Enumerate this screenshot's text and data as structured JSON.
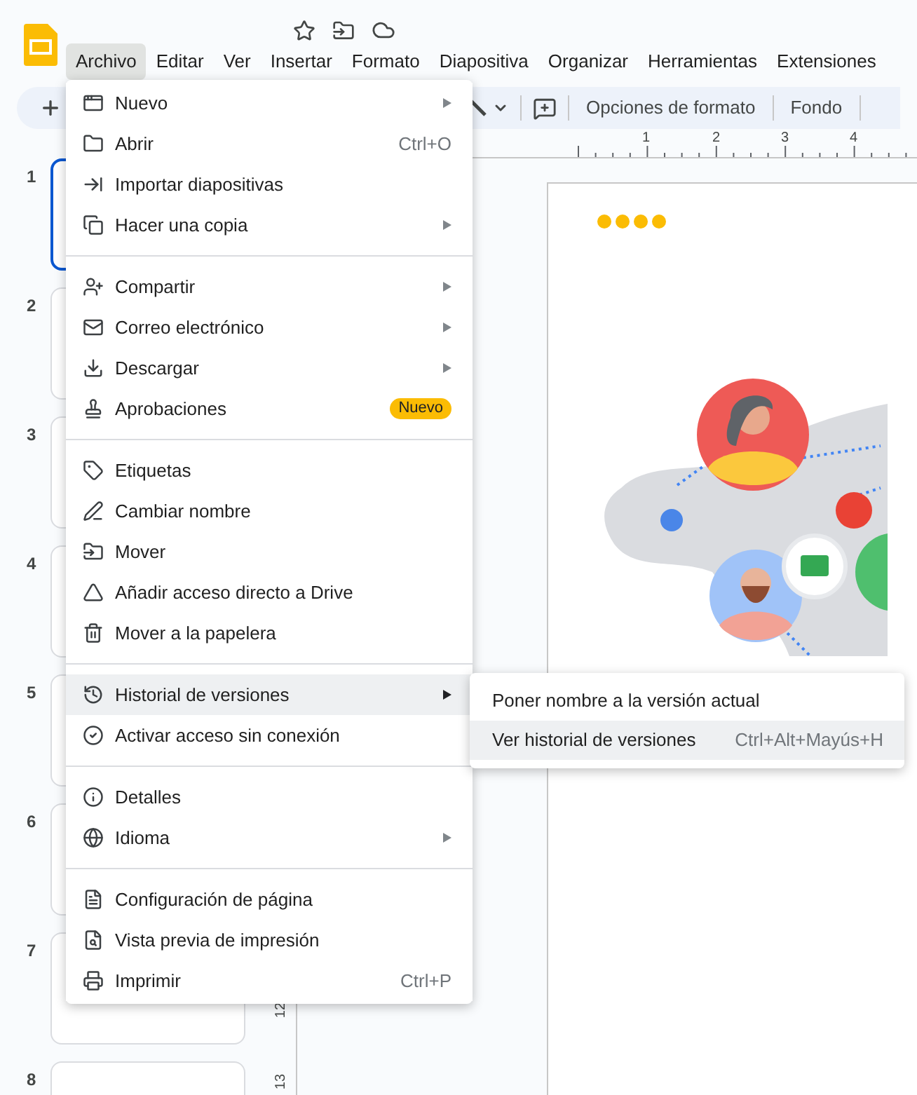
{
  "menu_bar": [
    {
      "label": "Archivo",
      "selected": true
    },
    {
      "label": "Editar",
      "selected": false
    },
    {
      "label": "Ver",
      "selected": false
    },
    {
      "label": "Insertar",
      "selected": false
    },
    {
      "label": "Formato",
      "selected": false
    },
    {
      "label": "Diapositiva",
      "selected": false
    },
    {
      "label": "Organizar",
      "selected": false
    },
    {
      "label": "Herramientas",
      "selected": false
    },
    {
      "label": "Extensiones",
      "selected": false
    }
  ],
  "toolbar": {
    "buttons": [
      "Opciones de formato",
      "Fondo"
    ]
  },
  "ruler": {
    "marks": [
      "1",
      "2",
      "3",
      "4"
    ]
  },
  "vertical_ruler": {
    "marks": [
      "12",
      "13"
    ]
  },
  "slides": [
    {
      "number": "1",
      "selected": true
    },
    {
      "number": "2",
      "selected": false
    },
    {
      "number": "3",
      "selected": false
    },
    {
      "number": "4",
      "selected": false
    },
    {
      "number": "5",
      "selected": false
    },
    {
      "number": "6",
      "selected": false
    },
    {
      "number": "7",
      "selected": false
    },
    {
      "number": "8",
      "selected": false
    }
  ],
  "file_menu": {
    "sections": [
      [
        {
          "label": "Nuevo",
          "has_submenu": true,
          "selected": false
        },
        {
          "label": "Abrir",
          "shortcut": "Ctrl+O",
          "has_submenu": false,
          "selected": false
        },
        {
          "label": "Importar diapositivas",
          "has_submenu": false,
          "selected": false
        },
        {
          "label": "Hacer una copia",
          "has_submenu": true,
          "selected": false
        }
      ],
      [
        {
          "label": "Compartir",
          "has_submenu": true,
          "selected": false
        },
        {
          "label": "Correo electrónico",
          "has_submenu": true,
          "selected": false
        },
        {
          "label": "Descargar",
          "has_submenu": true,
          "selected": false
        },
        {
          "label": "Aprobaciones",
          "badge": "Nuevo",
          "has_submenu": false,
          "selected": false
        }
      ],
      [
        {
          "label": "Etiquetas",
          "has_submenu": false,
          "selected": false
        },
        {
          "label": "Cambiar nombre",
          "has_submenu": false,
          "selected": false
        },
        {
          "label": "Mover",
          "has_submenu": false,
          "selected": false
        },
        {
          "label": "Añadir acceso directo a Drive",
          "has_submenu": false,
          "selected": false
        },
        {
          "label": "Mover a la papelera",
          "has_submenu": false,
          "selected": false
        }
      ],
      [
        {
          "label": "Historial de versiones",
          "has_submenu": true,
          "selected": true
        },
        {
          "label": "Activar acceso sin conexión",
          "has_submenu": false,
          "selected": false
        }
      ],
      [
        {
          "label": "Detalles",
          "has_submenu": false,
          "selected": false
        },
        {
          "label": "Idioma",
          "has_submenu": true,
          "selected": false
        }
      ],
      [
        {
          "label": "Configuración de página",
          "has_submenu": false,
          "selected": false
        },
        {
          "label": "Vista previa de impresión",
          "has_submenu": false,
          "selected": false
        },
        {
          "label": "Imprimir",
          "shortcut": "Ctrl+P",
          "has_submenu": false,
          "selected": false
        }
      ]
    ]
  },
  "version_submenu": {
    "items": [
      {
        "label": "Poner nombre a la versión actual",
        "selected": false
      },
      {
        "label": "Ver historial de versiones",
        "shortcut": "Ctrl+Alt+Mayús+H",
        "selected": true
      }
    ]
  }
}
